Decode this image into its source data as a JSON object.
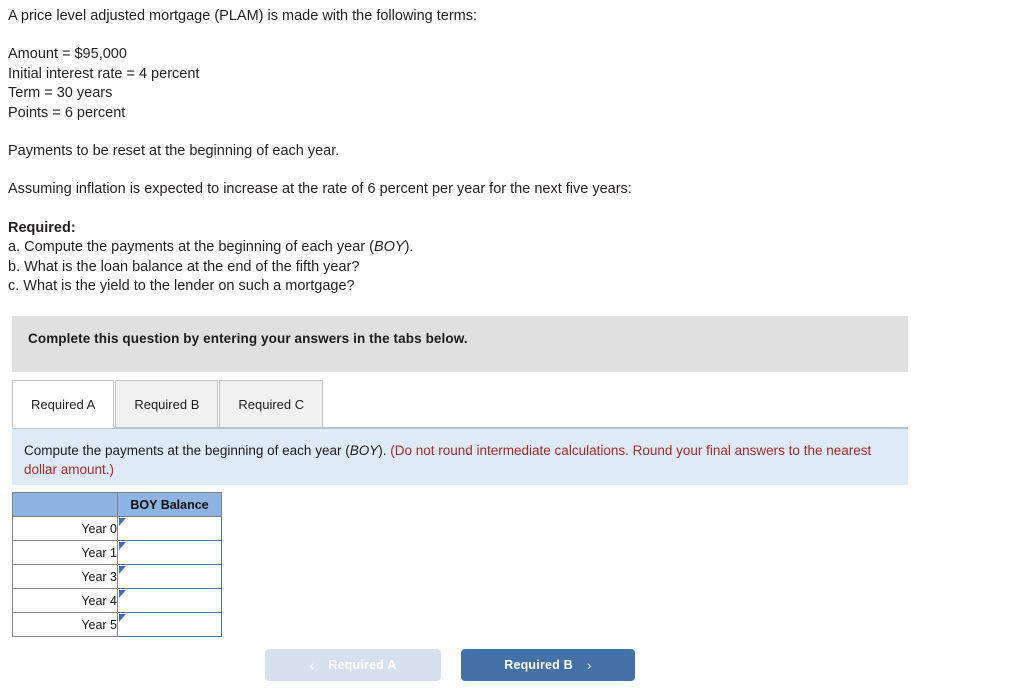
{
  "problem": {
    "intro": "A price level adjusted mortgage (PLAM) is made with the following terms:",
    "terms": [
      "Amount = $95,000",
      "Initial interest rate = 4 percent",
      "Term = 30 years",
      "Points = 6 percent"
    ],
    "reset_note": "Payments to be reset at the beginning of each year.",
    "inflation_note": "Assuming inflation is expected to increase at the rate of 6 percent per year for the next five years:",
    "required_label": "Required:",
    "required_a_pre": "a. Compute the payments at the beginning of each year (",
    "required_a_ital": "BOY",
    "required_a_post": ").",
    "required_b": "b. What is the loan balance at the end of the fifth year?",
    "required_c": "c. What is the yield to the lender on such a mortgage?"
  },
  "banner": {
    "text": "Complete this question by entering your answers in the tabs below."
  },
  "tabs": [
    {
      "label": "Required A",
      "active": true
    },
    {
      "label": "Required B",
      "active": false
    },
    {
      "label": "Required C",
      "active": false
    }
  ],
  "instruction": {
    "pre": "Compute the payments at the beginning of each year (",
    "ital": "BOY",
    "post": "). ",
    "red": "(Do not round intermediate calculations. Round your final answers to the nearest dollar amount.)"
  },
  "table": {
    "headers": [
      "",
      "BOY Balance"
    ],
    "rows": [
      {
        "label": "Year 0",
        "value": "",
        "placeholder": ""
      },
      {
        "label": "Year 1",
        "value": "",
        "placeholder": ""
      },
      {
        "label": "Year 3",
        "value": "",
        "placeholder": ""
      },
      {
        "label": "Year 4",
        "value": "",
        "placeholder": ""
      },
      {
        "label": "Year 5",
        "value": "",
        "placeholder": ""
      }
    ]
  },
  "nav": {
    "prev_label": "Required A",
    "prev_icon": "chevron-left-icon",
    "prev_glyph": "‹",
    "next_label": "Required B",
    "next_icon": "chevron-right-icon",
    "next_glyph": "›"
  },
  "colors": {
    "accent_blue": "#4472a8",
    "header_blue": "#8db4e2",
    "panel_blue": "#deebf7",
    "banner_gray": "#e0e0e0",
    "warning_red": "#a52a2a",
    "disabled_blue": "#d6e0ef"
  }
}
